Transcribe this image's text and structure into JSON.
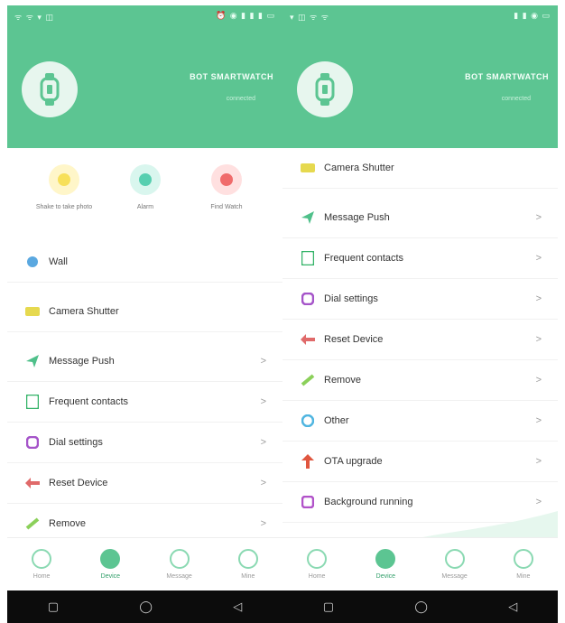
{
  "left": {
    "status": {
      "left": "ᯤ ᯤ ▾ ◫",
      "right": "⏰ ◉ ▮ ▮ ▮ ▭"
    },
    "device": {
      "name": "BOT SMARTWATCH",
      "sub": "connected"
    },
    "quick": [
      {
        "label": "Shake to take photo",
        "color": "#f7e05a",
        "bg": "#fff6c9",
        "icon": "camera-icon"
      },
      {
        "label": "Alarm",
        "color": "#57cfb0",
        "bg": "#d9f6ee",
        "icon": "alarm-icon"
      },
      {
        "label": "Find   Watch",
        "color": "#f06b6b",
        "bg": "#ffe0e0",
        "icon": "find-icon"
      }
    ],
    "menu": [
      {
        "label": "Wall",
        "icon": "wall-icon",
        "color": "#5aa8e0",
        "chev": ""
      },
      {
        "label": "Camera Shutter",
        "icon": "camera-icon",
        "color": "#e6d94f",
        "chev": ""
      },
      {
        "label": "Message Push",
        "icon": "send-icon",
        "color": "#4fc08a",
        "chev": ">"
      },
      {
        "label": "Frequent contacts",
        "icon": "contacts-icon",
        "color": "#34b368",
        "chev": ">"
      },
      {
        "label": "Dial settings",
        "icon": "dial-icon",
        "color": "#a554c9",
        "chev": ">"
      },
      {
        "label": "Reset Device",
        "icon": "reset-icon",
        "color": "#e06a6a",
        "chev": ">"
      },
      {
        "label": "Remove",
        "icon": "remove-icon",
        "color": "#8bd05a",
        "chev": ">"
      }
    ],
    "tabs": [
      {
        "label": "Home",
        "active": false
      },
      {
        "label": "Device",
        "active": true
      },
      {
        "label": "Message",
        "active": false
      },
      {
        "label": "Mine",
        "active": false
      }
    ],
    "nav": [
      "▢",
      "◯",
      "◁"
    ]
  },
  "right": {
    "status": {
      "left": "▾ ◫ ᯤ ᯤ",
      "right": "▮ ▮ ◉ ▭"
    },
    "device": {
      "name": "BOT SMARTWATCH",
      "sub": "connected"
    },
    "menu": [
      {
        "label": "Camera Shutter",
        "icon": "camera-icon",
        "color": "#e6d94f",
        "chev": ""
      },
      {
        "label": "Message Push",
        "icon": "send-icon",
        "color": "#4fc08a",
        "chev": ">"
      },
      {
        "label": "Frequent contacts",
        "icon": "contacts-icon",
        "color": "#34b368",
        "chev": ">"
      },
      {
        "label": "Dial settings",
        "icon": "dial-icon",
        "color": "#a554c9",
        "chev": ">"
      },
      {
        "label": "Reset Device",
        "icon": "reset-icon",
        "color": "#e06a6a",
        "chev": ">"
      },
      {
        "label": "Remove",
        "icon": "remove-icon",
        "color": "#8bd05a",
        "chev": ">"
      },
      {
        "label": "Other",
        "icon": "other-icon",
        "color": "#4fb5e0",
        "chev": ">"
      },
      {
        "label": "OTA upgrade",
        "icon": "upgrade-icon",
        "color": "#e0563f",
        "chev": ">"
      },
      {
        "label": "Background running",
        "icon": "background-icon",
        "color": "#b152c9",
        "chev": ">"
      }
    ],
    "tabs": [
      {
        "label": "Home",
        "active": false
      },
      {
        "label": "Device",
        "active": true
      },
      {
        "label": "Message",
        "active": false
      },
      {
        "label": "Mine",
        "active": false
      }
    ],
    "nav": [
      "▢",
      "◯",
      "◁"
    ]
  },
  "colors": {
    "brand": "#5cc592",
    "nav": "#0c0c0c"
  }
}
